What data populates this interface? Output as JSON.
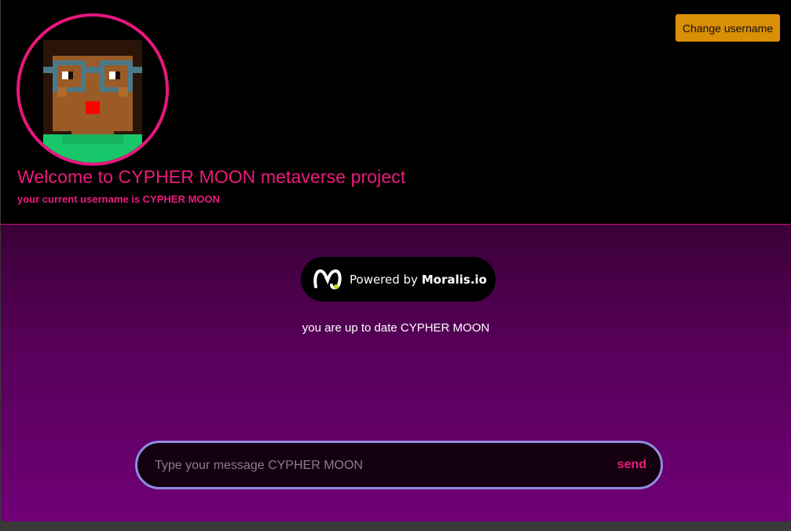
{
  "header": {
    "change_username_label": "Change username",
    "welcome_text": "Welcome to CYPHER MOON metaverse project",
    "username_text": "your current username is CYPHER MOON",
    "avatar_icon": "pixel-avatar-glasses"
  },
  "chat": {
    "powered_prefix": "Powered by",
    "powered_brand": "Moralis.io",
    "status_text": "you are up to date CYPHER MOON",
    "message_placeholder": "Type your message CYPHER MOON",
    "message_value": "",
    "send_label": "send"
  },
  "colors": {
    "accent_pink": "#ee1a7d",
    "button_orange": "#d98f06",
    "header_bg": "#000000",
    "chat_gradient_top": "#3b0037",
    "chat_gradient_bottom": "#700077",
    "input_border": "#8e8ee0"
  }
}
